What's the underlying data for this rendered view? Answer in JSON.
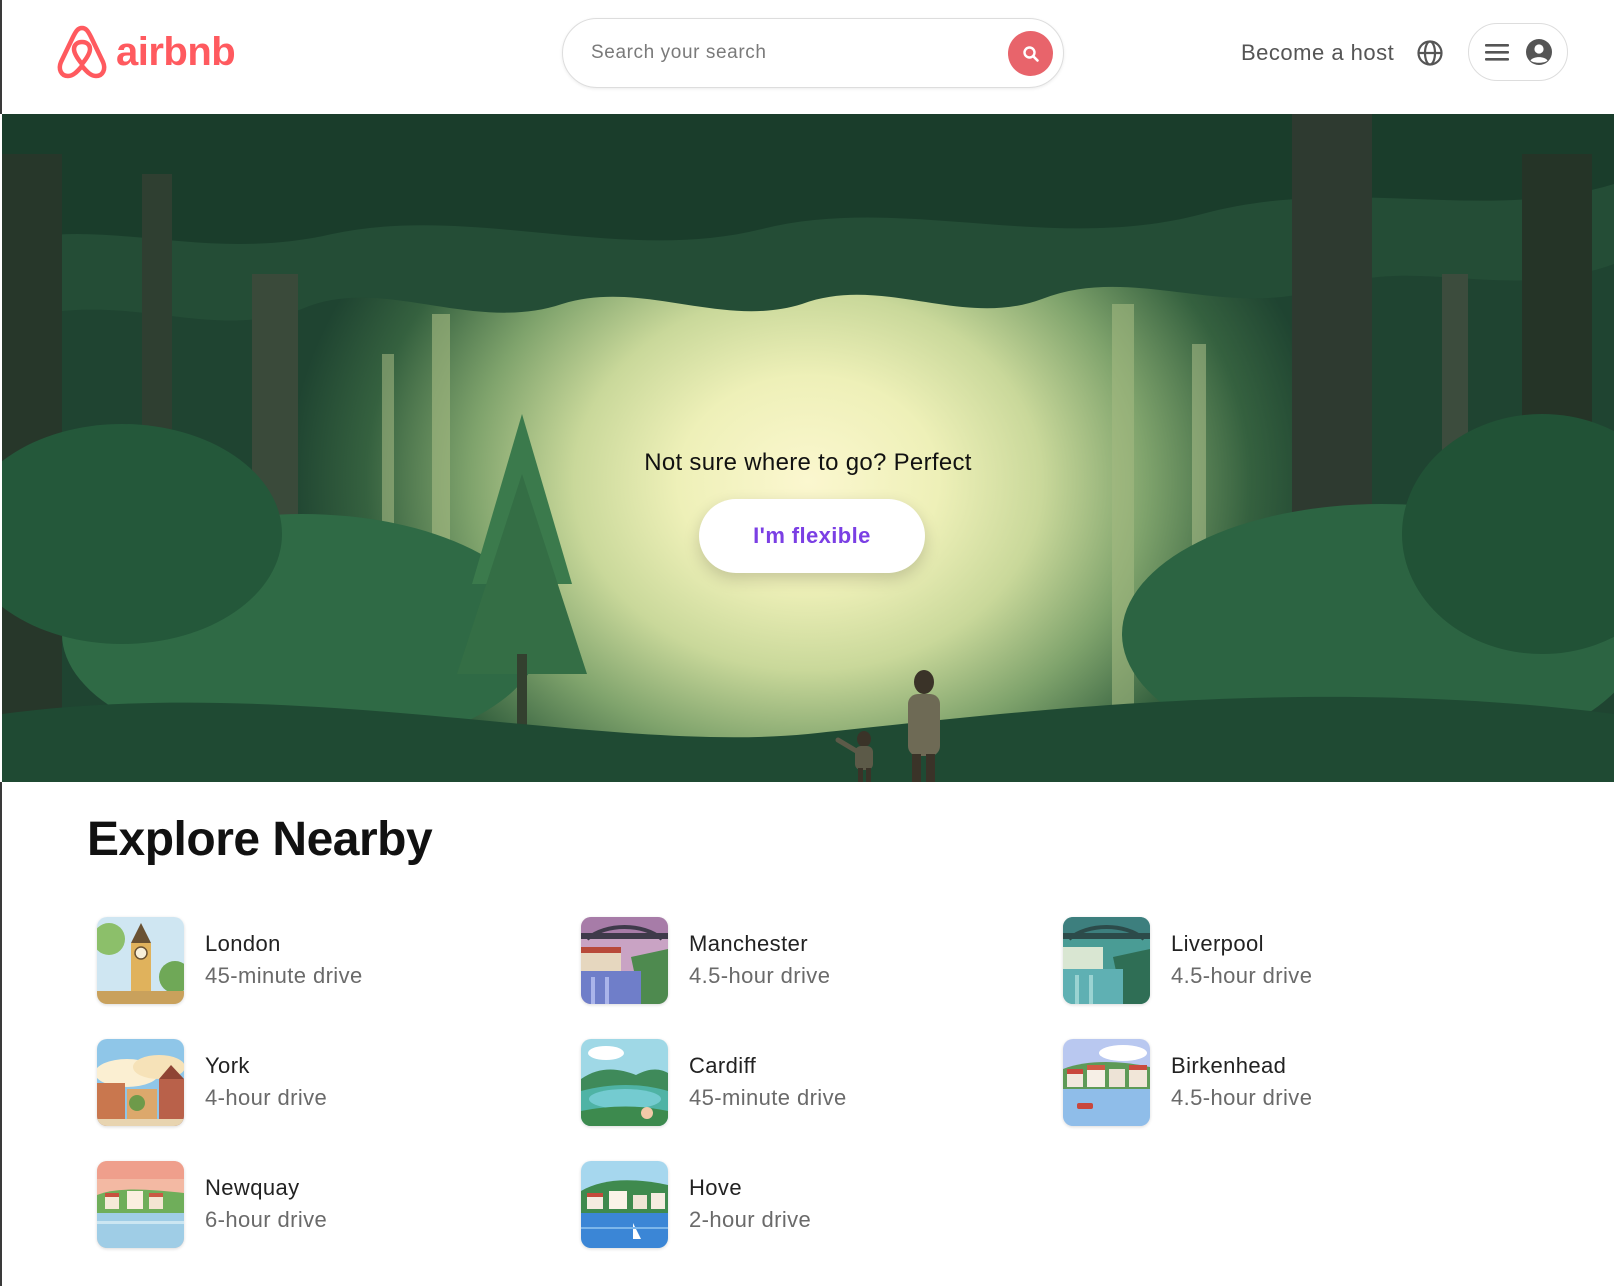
{
  "brand": {
    "name": "airbnb",
    "color": "#ff5a5f",
    "icon": "airbnb-belo-icon"
  },
  "search": {
    "placeholder": "Search your search",
    "button_color": "#e8646b",
    "icon": "search-icon"
  },
  "nav": {
    "host_label": "Become a host",
    "globe_icon": "globe-icon",
    "menu_icon": "hamburger-icon",
    "avatar_icon": "user-avatar-icon"
  },
  "hero": {
    "tagline": "Not sure where to go? Perfect",
    "button_label": "I'm flexible",
    "button_color": "#7b3fe4"
  },
  "explore": {
    "title": "Explore Nearby",
    "items": [
      {
        "city": "London",
        "distance": "45-minute drive"
      },
      {
        "city": "Manchester",
        "distance": "4.5-hour drive"
      },
      {
        "city": "Liverpool",
        "distance": "4.5-hour drive"
      },
      {
        "city": "York",
        "distance": "4-hour drive"
      },
      {
        "city": "Cardiff",
        "distance": "45-minute drive"
      },
      {
        "city": "Birkenhead",
        "distance": "4.5-hour drive"
      },
      {
        "city": "Newquay",
        "distance": "6-hour drive"
      },
      {
        "city": "Hove",
        "distance": "2-hour drive"
      }
    ]
  }
}
